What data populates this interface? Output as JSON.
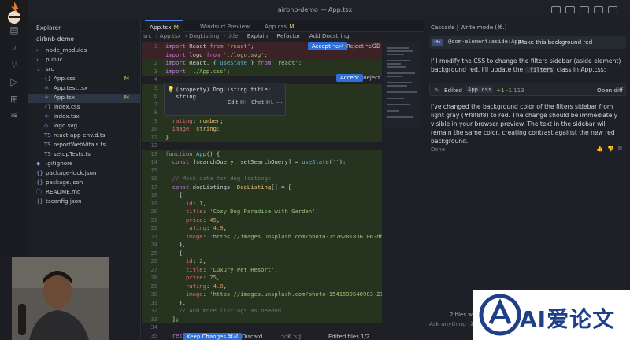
{
  "window": {
    "title": "airbnb-demo — App.tsx"
  },
  "explorer": {
    "title": "Explorer",
    "project": "airbnb-demo",
    "items": [
      {
        "label": "node_modules",
        "icon": "›",
        "depth": 1
      },
      {
        "label": "public",
        "icon": "›",
        "depth": 1
      },
      {
        "label": "src",
        "icon": "⌄",
        "depth": 1
      },
      {
        "label": "App.css",
        "icon": "{}",
        "depth": 2,
        "badge": "M"
      },
      {
        "label": "App.test.tsx",
        "icon": "⚛",
        "depth": 2
      },
      {
        "label": "App.tsx",
        "icon": "⚛",
        "depth": 2,
        "badge": "M",
        "selected": true
      },
      {
        "label": "index.css",
        "icon": "{}",
        "depth": 2
      },
      {
        "label": "index.tsx",
        "icon": "⚛",
        "depth": 2
      },
      {
        "label": "logo.svg",
        "icon": "◇",
        "depth": 2
      },
      {
        "label": "react-app-env.d.ts",
        "icon": "TS",
        "depth": 2
      },
      {
        "label": "reportWebVitals.ts",
        "icon": "TS",
        "depth": 2
      },
      {
        "label": "setupTests.ts",
        "icon": "TS",
        "depth": 2
      },
      {
        "label": ".gitignore",
        "icon": "◆",
        "depth": 1
      },
      {
        "label": "package-lock.json",
        "icon": "{}",
        "depth": 1
      },
      {
        "label": "package.json",
        "icon": "{}",
        "depth": 1
      },
      {
        "label": "README.md",
        "icon": "ⓘ",
        "depth": 1
      },
      {
        "label": "tsconfig.json",
        "icon": "{}",
        "depth": 1
      }
    ]
  },
  "editor": {
    "tabs": [
      {
        "label": "App.tsx",
        "modified": "M",
        "active": true
      },
      {
        "label": "Windsurf Preview",
        "modified": ""
      },
      {
        "label": "App.css",
        "modified": "M"
      }
    ],
    "breadcrumb": [
      "src",
      "App.tsx",
      "DogListing",
      "title"
    ],
    "code_lens": [
      "Explain",
      "Refactor",
      "Add Docstring"
    ],
    "accept_label": "Accept ⌥⏎",
    "reject_label": "Reject ⌥⌫",
    "accept2_label": "Accept",
    "reject2_label": "Reject",
    "hover": {
      "text": "(property) DogListing.title: string",
      "edit_label": "Edit",
      "edit_kbd": "⌘I",
      "chat_label": "Chat",
      "chat_kbd": "⌘L"
    },
    "bottom": {
      "keep_label": "Keep Changes ⌘⏎",
      "discard_label": "Discard",
      "nav_label": "⌥K ⌥J",
      "edited_label": "Edited files 1/2"
    }
  },
  "cascade": {
    "title": "Cascade | Write mode (⌘.)",
    "user_tag": "@dom-element:aside:App",
    "user_text": "Make this background red",
    "para1": "I'll modify the CSS to change the filters sidebar (aside element) background red. I'll update the",
    "para1_chip": ".filters",
    "para1_tail": "class in App.css:",
    "edit_card": {
      "label": "Edited",
      "file": "App.css",
      "diff": "+1 -1",
      "count": "113",
      "action": "Open diff"
    },
    "para2": "I've changed the background color of the filters sidebar from light gray (#f8f8f8) to red. The change should be immediately visible in your browser preview. The text in the sidebar will remain the same color, creating contrast against the new red background.",
    "done": "Done",
    "files_changed": "2 files w",
    "ask_placeholder": "Ask anything (⌘L)"
  },
  "watermark": {
    "text": "AI爱论文"
  }
}
